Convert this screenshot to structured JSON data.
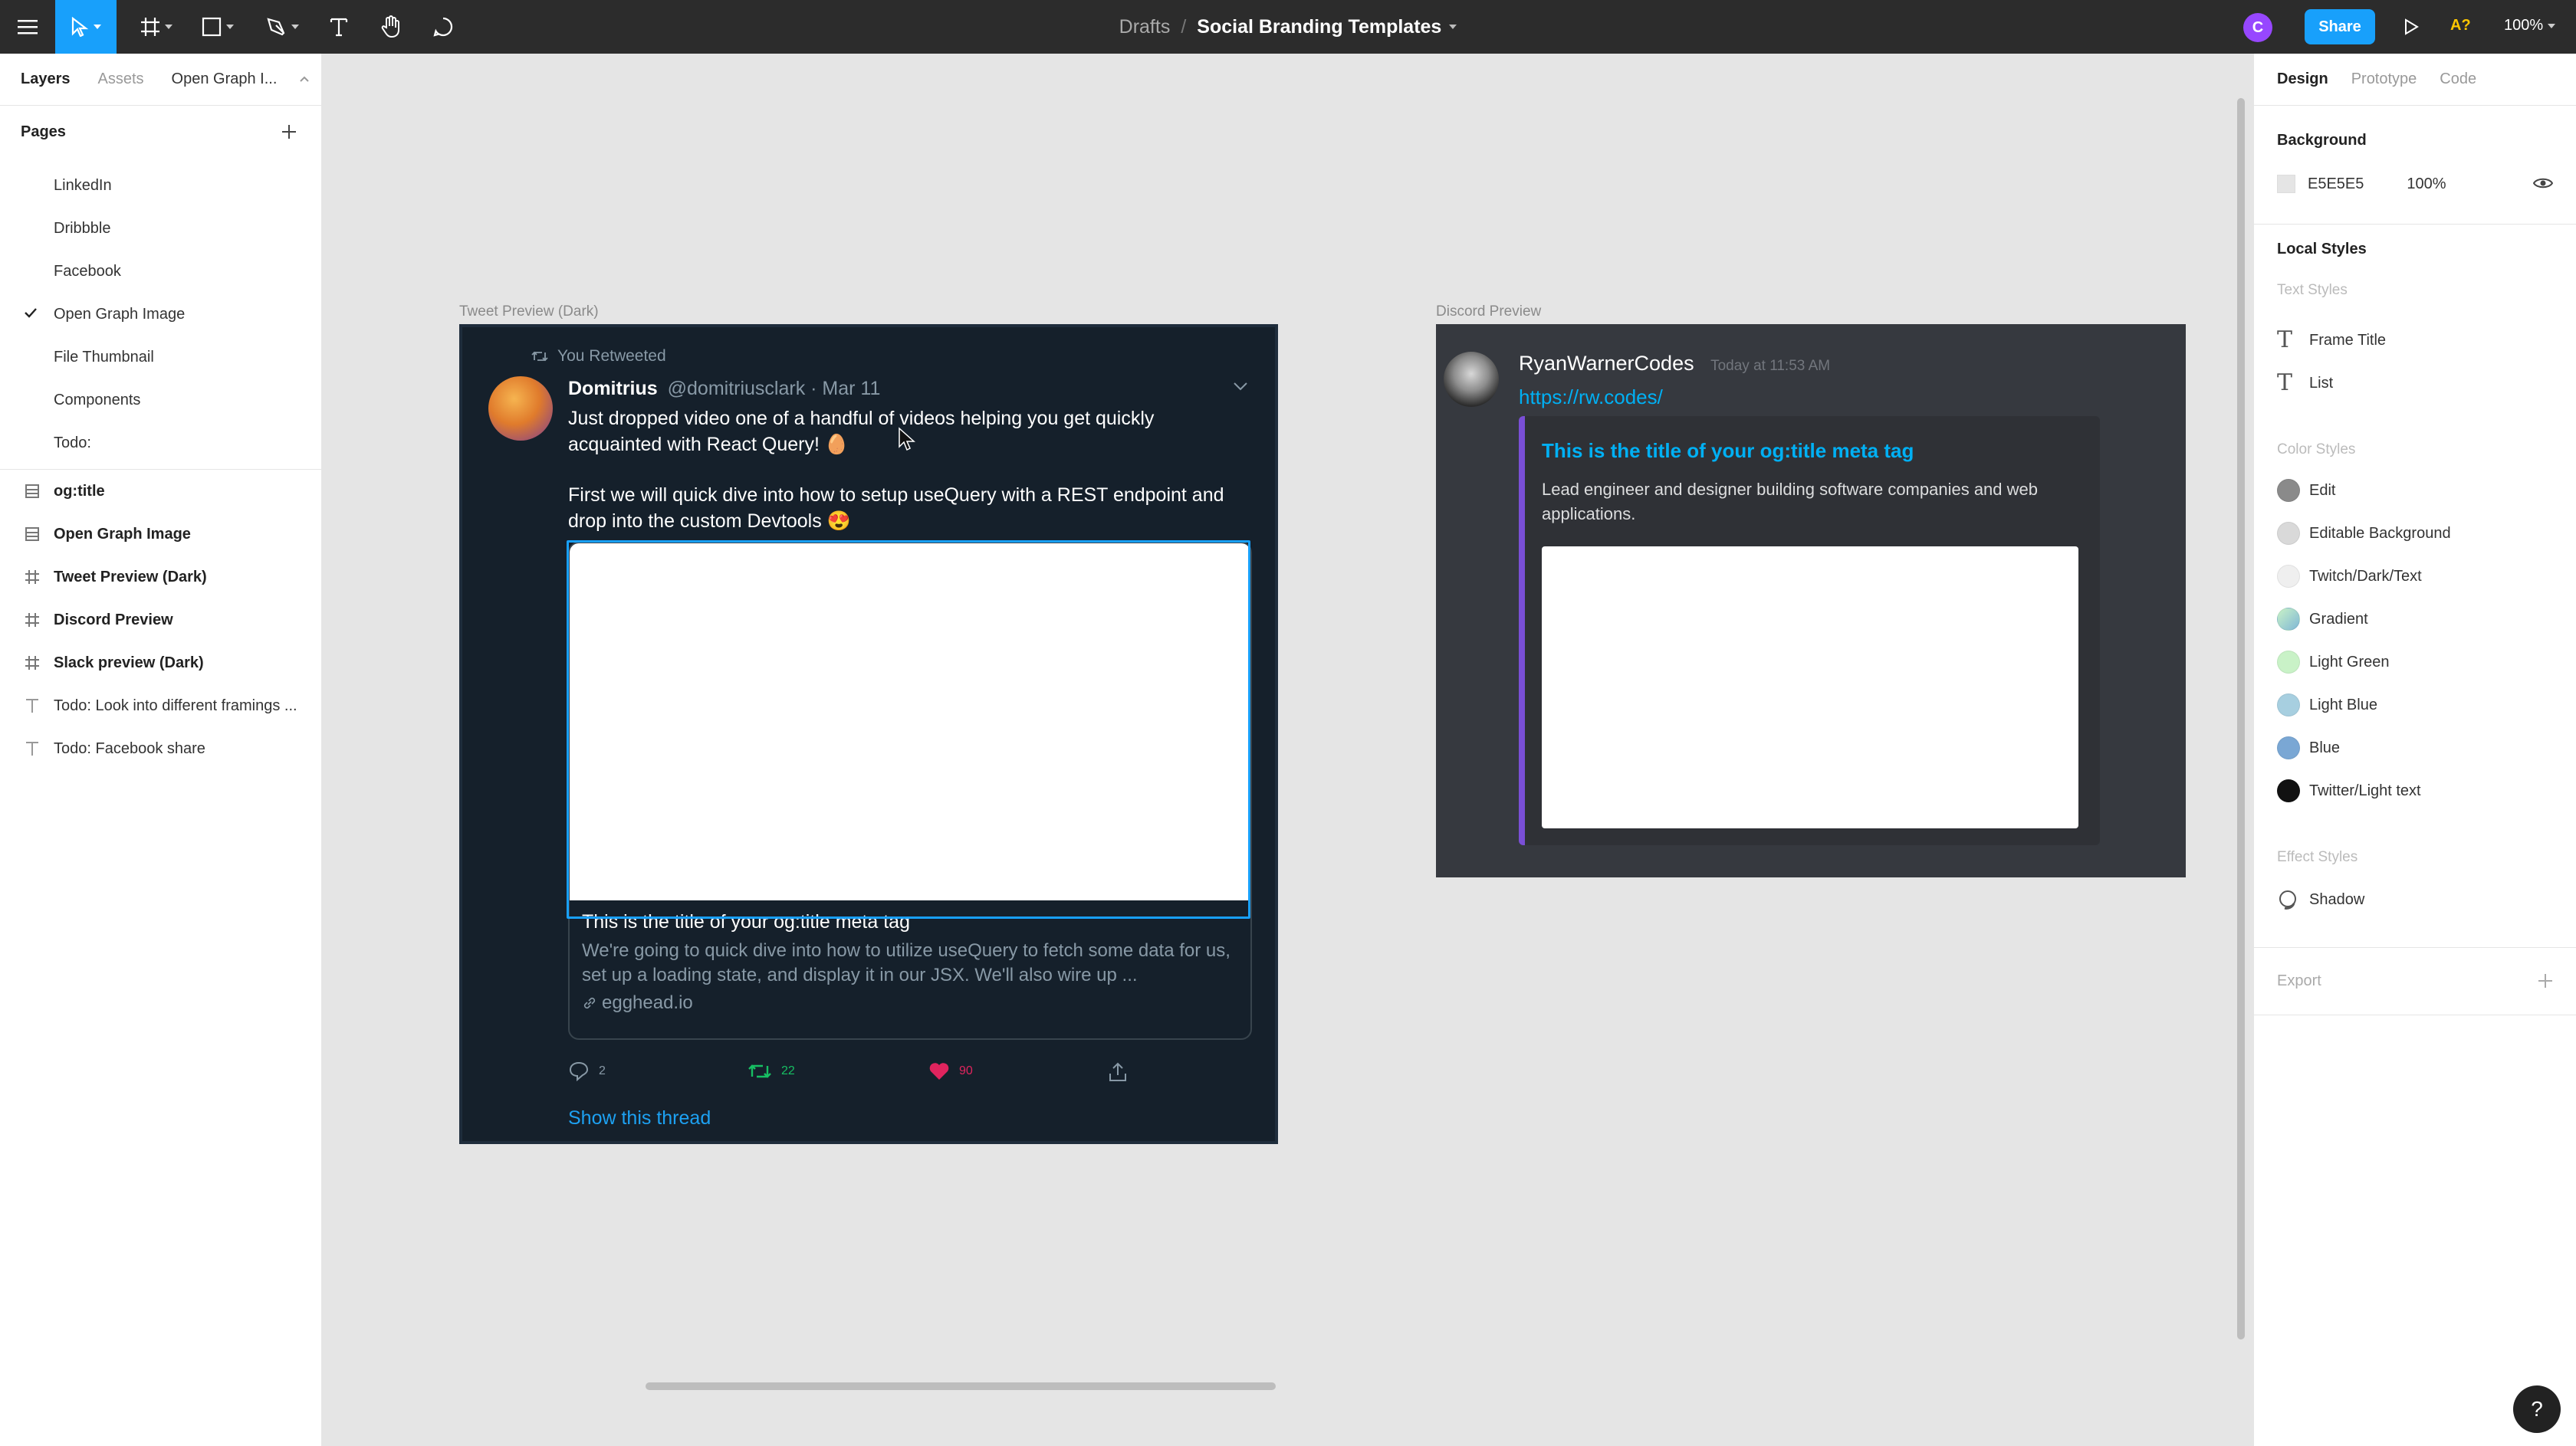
{
  "toolbar": {
    "crumb": "Drafts",
    "separator": "/",
    "doc_title": "Social Branding Templates",
    "user_initial": "C",
    "share_label": "Share",
    "a_indicator": "A?",
    "zoom": "100%"
  },
  "left_panel": {
    "tabs": [
      "Layers",
      "Assets",
      "Open Graph I..."
    ],
    "pages_title": "Pages",
    "pages": [
      "LinkedIn",
      "Dribbble",
      "Facebook",
      "Open Graph Image",
      "File Thumbnail",
      "Components",
      "Todo:"
    ],
    "layers": [
      {
        "label": "og:title",
        "icon": "component-list-icon"
      },
      {
        "label": "Open Graph Image",
        "icon": "component-list-icon"
      },
      {
        "label": "Tweet Preview (Dark)",
        "icon": "frame-icon"
      },
      {
        "label": "Discord Preview",
        "icon": "frame-icon"
      },
      {
        "label": "Slack preview (Dark)",
        "icon": "frame-icon"
      },
      {
        "label": "Todo: Look into different framings ...",
        "icon": "text-icon"
      },
      {
        "label": "Todo: Facebook share",
        "icon": "text-icon"
      }
    ]
  },
  "canvas": {
    "tweet_frame_label": "Tweet Preview (Dark)",
    "discord_frame_label": "Discord Preview",
    "tweet": {
      "retweeted": "You Retweeted",
      "name": "Domitrius",
      "meta": "@domitriusclark · Mar 11",
      "text1": "Just dropped video one of a handful of videos helping you get quickly acquainted with React Query! 🥚",
      "text2": "First we will quick dive into how to setup useQuery with a REST endpoint and drop into the custom Devtools 😍",
      "card_title": "This is the title of your og:title meta tag",
      "card_desc": "We're going to quick dive into how to utilize useQuery to fetch some data for us, set up a loading state, and display it in our JSX. We'll also wire up ...",
      "card_link": "egghead.io",
      "replies": "2",
      "retweets": "22",
      "likes": "90",
      "show_thread": "Show this thread"
    },
    "discord": {
      "name": "RyanWarnerCodes",
      "time": "Today at 11:53 AM",
      "link": "https://rw.codes/",
      "embed_title": "This is the title of your og:title meta tag",
      "embed_desc": "Lead engineer and designer building software companies and web applications."
    }
  },
  "right_panel": {
    "tabs": [
      "Design",
      "Prototype",
      "Code"
    ],
    "background_title": "Background",
    "background_hex": "E5E5E5",
    "background_opacity": "100%",
    "local_styles_title": "Local Styles",
    "text_styles_title": "Text Styles",
    "text_styles": [
      "Frame Title",
      "List"
    ],
    "color_styles_title": "Color Styles",
    "color_styles": [
      {
        "label": "Edit",
        "color": "#8a8a8a"
      },
      {
        "label": "Editable Background",
        "color": "#d9d9d9"
      },
      {
        "label": "Twitch/Dark/Text",
        "color": "#efefef"
      },
      {
        "label": "Gradient",
        "color": "#9fd8c5"
      },
      {
        "label": "Light Green",
        "color": "#c9f2c7"
      },
      {
        "label": "Light Blue",
        "color": "#a7cfe0"
      },
      {
        "label": "Blue",
        "color": "#7aa7d4"
      },
      {
        "label": "Twitter/Light text",
        "color": "#111111"
      }
    ],
    "effect_styles_title": "Effect Styles",
    "effect_styles": [
      "Shadow"
    ],
    "export_title": "Export"
  },
  "help": "?"
}
